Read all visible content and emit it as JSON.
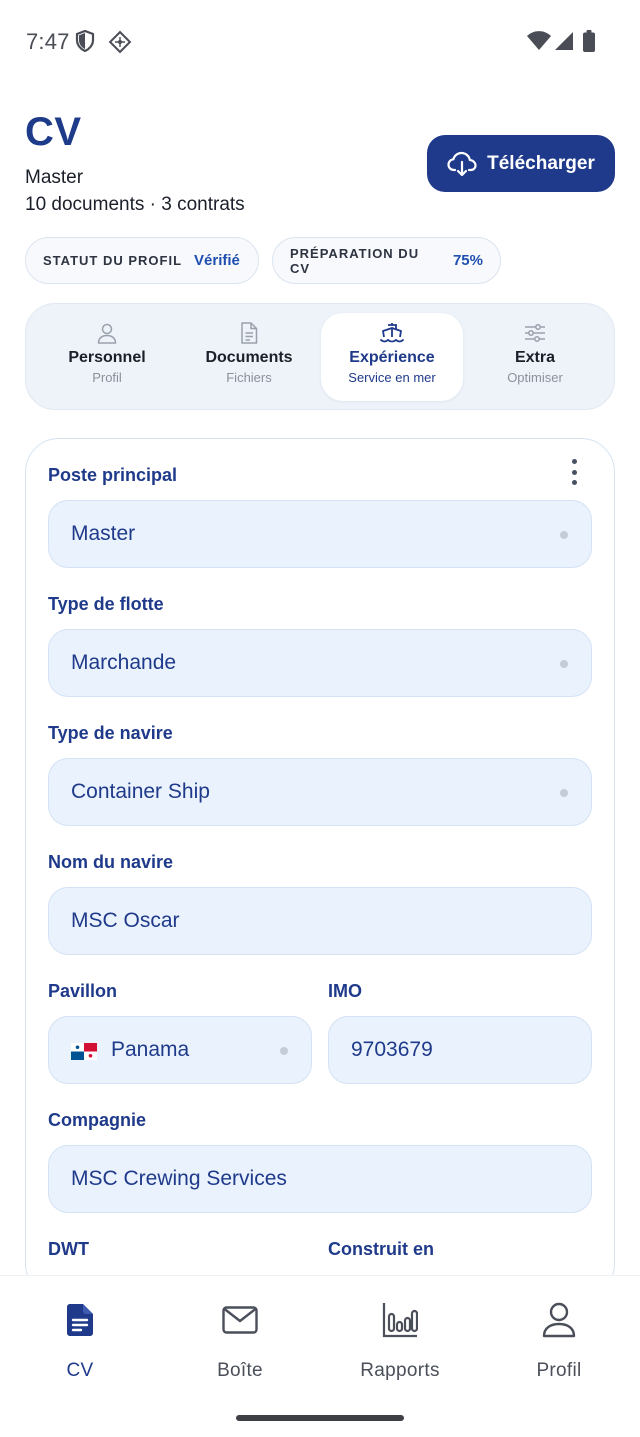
{
  "status_bar": {
    "time": "7:47"
  },
  "header": {
    "title": "CV",
    "subtitle": "Master",
    "meta": "10 documents · 3 contrats",
    "download_label": "Télécharger"
  },
  "chips": [
    {
      "label": "STATUT DU PROFIL",
      "value": "Vérifié"
    },
    {
      "label": "PRÉPARATION DU CV",
      "value": "75%"
    }
  ],
  "tabs": [
    {
      "label": "Personnel",
      "sub": "Profil",
      "icon": "user-icon"
    },
    {
      "label": "Documents",
      "sub": "Fichiers",
      "icon": "document-icon"
    },
    {
      "label": "Expérience",
      "sub": "Service en mer",
      "icon": "ship-icon",
      "active": true
    },
    {
      "label": "Extra",
      "sub": "Optimiser",
      "icon": "sliders-icon"
    }
  ],
  "form": {
    "position": {
      "label": "Poste principal",
      "value": "Master"
    },
    "fleet_type": {
      "label": "Type de flotte",
      "value": "Marchande"
    },
    "vessel_type": {
      "label": "Type de navire",
      "value": "Container Ship"
    },
    "vessel_name": {
      "label": "Nom du navire",
      "value": "MSC Oscar"
    },
    "flag": {
      "label": "Pavillon",
      "value": "Panama"
    },
    "imo": {
      "label": "IMO",
      "value": "9703679"
    },
    "company": {
      "label": "Compagnie",
      "value": "MSC Crewing Services"
    },
    "dwt": {
      "label": "DWT"
    },
    "built": {
      "label": "Construit en"
    }
  },
  "bottom_nav": [
    {
      "label": "CV",
      "icon": "cv-document-icon",
      "active": true
    },
    {
      "label": "Boîte",
      "icon": "mail-icon"
    },
    {
      "label": "Rapports",
      "icon": "bar-chart-icon"
    },
    {
      "label": "Profil",
      "icon": "profile-icon"
    }
  ],
  "colors": {
    "primary": "#1f3a8a",
    "field_bg": "#eaf2fd",
    "accent_text": "#1f4fb0"
  }
}
